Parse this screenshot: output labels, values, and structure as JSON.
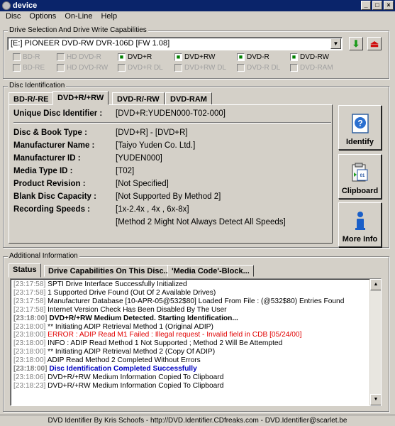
{
  "window": {
    "title": "device",
    "minimize": "_",
    "maximize": "□",
    "close": "×"
  },
  "menu": [
    "Disc",
    "Options",
    "On-Line",
    "Help"
  ],
  "drive": {
    "group_label": "Drive Selection And Drive Write Capabilities",
    "selected": "[E:] PIONEER DVD-RW  DVR-106D [FW 1.08]",
    "capabilities": [
      {
        "label": "BD-R",
        "checked": false
      },
      {
        "label": "HD DVD-R",
        "checked": false
      },
      {
        "label": "DVD+R",
        "checked": true
      },
      {
        "label": "DVD+RW",
        "checked": true
      },
      {
        "label": "DVD-R",
        "checked": true
      },
      {
        "label": "DVD-RW",
        "checked": true
      },
      {
        "label": "BD-RE",
        "checked": false
      },
      {
        "label": "HD DVD-RW",
        "checked": false
      },
      {
        "label": "DVD+R DL",
        "checked": false
      },
      {
        "label": "DVD+RW DL",
        "checked": false
      },
      {
        "label": "DVD-R DL",
        "checked": false
      },
      {
        "label": "DVD-RAM",
        "checked": false
      }
    ]
  },
  "disc": {
    "group_label": "Disc Identification",
    "tabs": [
      "BD-R/-RE",
      "DVD+R/+RW",
      "DVD-R/-RW",
      "DVD-RAM"
    ],
    "active_tab": 1,
    "uid_label": "Unique Disc Identifier :",
    "uid_value": "[DVD+R:YUDEN000-T02-000]",
    "fields": [
      {
        "label": "Disc & Book Type :",
        "value": "[DVD+R] - [DVD+R]"
      },
      {
        "label": "Manufacturer Name :",
        "value": "[Taiyo Yuden Co. Ltd.]"
      },
      {
        "label": "Manufacturer ID :",
        "value": "[YUDEN000]"
      },
      {
        "label": "Media Type ID :",
        "value": "[T02]"
      },
      {
        "label": "Product Revision :",
        "value": "[Not Specified]"
      },
      {
        "label": "Blank Disc Capacity :",
        "value": "[Not Supported By Method 2]"
      },
      {
        "label": "Recording Speeds :",
        "value": "[1x-2.4x , 4x , 6x-8x]"
      },
      {
        "label": "",
        "value": "[Method 2 Might Not Always Detect All Speeds]"
      }
    ],
    "buttons": [
      {
        "label": "Identify",
        "icon": "help-icon"
      },
      {
        "label": "Clipboard",
        "icon": "clipboard-icon"
      },
      {
        "label": "More Info",
        "icon": "info-icon"
      }
    ]
  },
  "additional": {
    "group_label": "Additional Information",
    "tabs": [
      "Status",
      "Drive Capabilities On This Disc...",
      "'Media Code'-Block..."
    ],
    "active_tab": 0,
    "log": [
      {
        "ts": "[23:17:58]",
        "text": "SPTI Drive Interface Successfully Initialized",
        "style": ""
      },
      {
        "ts": "[23:17:58]",
        "text": "1 Supported Drive Found (Out Of 2 Available Drives)",
        "style": ""
      },
      {
        "ts": "[23:17:58]",
        "text": "Manufacturer Database [10-APR-05@532$80] Loaded From File : (@532$80) Entries Found",
        "style": ""
      },
      {
        "ts": "[23:17:58]",
        "text": "Internet Version Check Has Been Disabled By The User",
        "style": ""
      },
      {
        "ts": "[23:18:00]",
        "text": "DVD+R/+RW Medium Detected. Starting Identification...",
        "style": "bold"
      },
      {
        "ts": "[23:18:00]",
        "text": "** Initiating ADIP Retrieval Method 1 (Original ADIP)",
        "style": ""
      },
      {
        "ts": "[23:18:00]",
        "text": "ERROR : ADIP Read M1 Failed : Illegal request - Invalid field in CDB [05/24/00]",
        "style": "red"
      },
      {
        "ts": "[23:18:00]",
        "text": "INFO : ADIP Read Method 1 Not Supported ; Method 2 Will Be Attempted",
        "style": ""
      },
      {
        "ts": "[23:18:00]",
        "text": "** Initiating ADIP Retrieval Method 2 (Copy Of ADIP)",
        "style": ""
      },
      {
        "ts": "[23:18:00]",
        "text": "ADIP Read Method 2 Completed Without Errors",
        "style": ""
      },
      {
        "ts": "[23:18:00]",
        "text": "Disc Identification Completed Successfully",
        "style": "blue"
      },
      {
        "ts": "[23:18:06]",
        "text": "DVD+R/+RW Medium Information Copied To Clipboard",
        "style": ""
      },
      {
        "ts": "[23:18:23]",
        "text": "DVD+R/+RW Medium Information Copied To Clipboard",
        "style": ""
      }
    ]
  },
  "statusbar": "DVD Identifier By Kris Schoofs  -  http://DVD.Identifier.CDfreaks.com  -  DVD.Identifier@scarlet.be",
  "colors": {
    "title_bar": "#0a246a",
    "face": "#d4d0c8",
    "error": "#e00000",
    "success": "#0000c0",
    "check": "#008000"
  }
}
